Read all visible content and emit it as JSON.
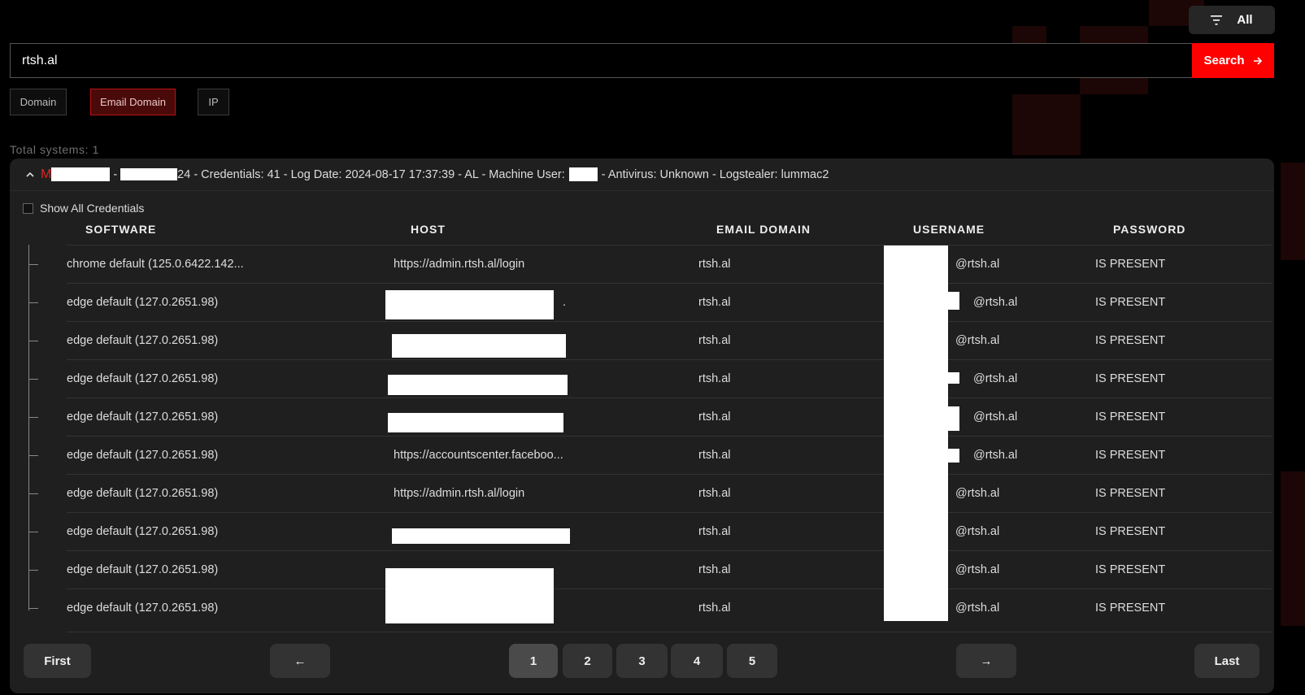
{
  "filter": {
    "label": "All"
  },
  "search": {
    "value": "rtsh.al",
    "button_label": "Search"
  },
  "search_types": [
    "Domain",
    "Email Domain",
    "IP"
  ],
  "search_types_active": "Email Domain",
  "total_systems": "Total systems: 1",
  "system": {
    "name_prefix": "M",
    "separator": "-",
    "id_suffix": "24",
    "details": "- Credentials: 41 - Log Date: 2024-08-17 17:37:39 - AL - Machine User:",
    "details_tail": "- Antivirus: Unknown - Logstealer: lummac2"
  },
  "show_all_label": "Show All Credentials",
  "columns": [
    "SOFTWARE",
    "HOST",
    "EMAIL DOMAIN",
    "USERNAME",
    "PASSWORD"
  ],
  "rows": [
    {
      "software": "chrome default (125.0.6422.142...",
      "host": "https://admin.rtsh.al/login",
      "domain": "rtsh.al",
      "user": "@rtsh.al",
      "pass": "IS PRESENT"
    },
    {
      "software": "edge default (127.0.2651.98)",
      "host": ".",
      "domain": "rtsh.al",
      "user": "@rtsh.al",
      "pass": "IS PRESENT"
    },
    {
      "software": "edge default (127.0.2651.98)",
      "host": "",
      "domain": "rtsh.al",
      "user": "@rtsh.al",
      "pass": "IS PRESENT"
    },
    {
      "software": "edge default (127.0.2651.98)",
      "host": "",
      "domain": "rtsh.al",
      "user": "@rtsh.al",
      "pass": "IS PRESENT"
    },
    {
      "software": "edge default (127.0.2651.98)",
      "host": "",
      "domain": "rtsh.al",
      "user": "@rtsh.al",
      "pass": "IS PRESENT"
    },
    {
      "software": "edge default (127.0.2651.98)",
      "host": "https://accountscenter.faceboo...",
      "domain": "rtsh.al",
      "user": "@rtsh.al",
      "pass": "IS PRESENT"
    },
    {
      "software": "edge default (127.0.2651.98)",
      "host": "https://admin.rtsh.al/login",
      "domain": "rtsh.al",
      "user": "@rtsh.al",
      "pass": "IS PRESENT"
    },
    {
      "software": "edge default (127.0.2651.98)",
      "host": "",
      "domain": "rtsh.al",
      "user": "@rtsh.al",
      "pass": "IS PRESENT"
    },
    {
      "software": "edge default (127.0.2651.98)",
      "host": "",
      "domain": "rtsh.al",
      "user": "@rtsh.al",
      "pass": "IS PRESENT"
    },
    {
      "software": "edge default (127.0.2651.98)",
      "host": "",
      "domain": "rtsh.al",
      "user": "@rtsh.al",
      "pass": "IS PRESENT"
    }
  ],
  "pagination": {
    "first": "First",
    "prev": "←",
    "pages": [
      "1",
      "2",
      "3",
      "4",
      "5"
    ],
    "current": "1",
    "next": "→",
    "last": "Last"
  },
  "colors": {
    "accent": "#ff0000",
    "panel": "#1f1f1f",
    "background": "#000000"
  }
}
